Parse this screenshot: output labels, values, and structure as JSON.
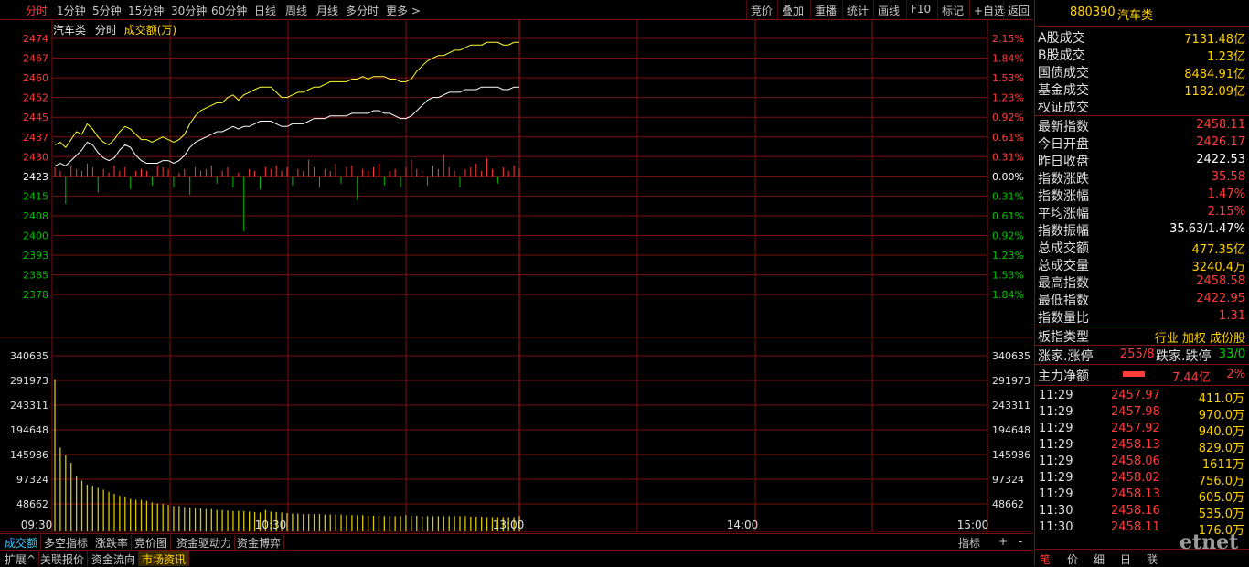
{
  "toolbar": {
    "periods": [
      "分时",
      "1分钟",
      "5分钟",
      "15分钟",
      "30分钟",
      "60分钟",
      "日线",
      "周线",
      "月线",
      "多分时",
      "更多 >"
    ],
    "active_period": "分时",
    "actions": [
      "竞价",
      "叠加",
      "重播",
      "统计",
      "画线",
      "F10",
      "标记",
      "+自选",
      "返回"
    ]
  },
  "chart_header": {
    "name": "汽车类",
    "mode": "分时",
    "indicator": "成交额(万)"
  },
  "chart_data": {
    "type": "line",
    "x_ticks": [
      "09:30",
      "10:30",
      "13:00",
      "14:00",
      "15:00"
    ],
    "price_ticks_left": [
      "2474",
      "2467",
      "2460",
      "2452",
      "2445",
      "2437",
      "2430",
      "2423",
      "2415",
      "2408",
      "2400",
      "2393",
      "2385",
      "2378"
    ],
    "pct_ticks_right": [
      "2.15%",
      "1.84%",
      "1.53%",
      "1.23%",
      "0.92%",
      "0.61%",
      "0.31%",
      "0.00%",
      "0.31%",
      "0.61%",
      "0.92%",
      "1.23%",
      "1.53%",
      "1.84%"
    ],
    "volume_ticks": [
      "340635",
      "291973",
      "243311",
      "194648",
      "145986",
      "97324",
      "48662"
    ],
    "ylim": [
      2378,
      2474
    ],
    "prev_close": 2422.53,
    "volume_ylim": [
      0,
      340635
    ],
    "series": [
      {
        "values": [
          2435,
          2436,
          2434,
          2437,
          2440,
          2439,
          2443,
          2441,
          2438,
          2436,
          2435,
          2437,
          2440,
          2442,
          2441,
          2439,
          2437,
          2437,
          2436,
          2437,
          2438,
          2437,
          2436,
          2437,
          2439,
          2443,
          2446,
          2448,
          2449,
          2450,
          2451,
          2451,
          2453,
          2454,
          2452,
          2454,
          2455,
          2456,
          2457,
          2457,
          2457,
          2455,
          2453,
          2453,
          2454,
          2455,
          2455,
          2456,
          2457,
          2457,
          2458,
          2459,
          2459,
          2459,
          2459,
          2460,
          2460,
          2461,
          2460,
          2461,
          2461,
          2461,
          2460,
          2460,
          2459,
          2459,
          2460,
          2463,
          2465,
          2467,
          2468,
          2469,
          2469,
          2470,
          2471,
          2471,
          2472,
          2473,
          2473,
          2473,
          2474,
          2474,
          2474,
          2473,
          2473,
          2474,
          2474
        ]
      },
      {
        "values": [
          2427,
          2428,
          2427,
          2429,
          2431,
          2433,
          2436,
          2435,
          2432,
          2430,
          2429,
          2430,
          2433,
          2435,
          2434,
          2431,
          2429,
          2428,
          2428,
          2428,
          2429,
          2429,
          2428,
          2429,
          2431,
          2434,
          2436,
          2437,
          2438,
          2439,
          2440,
          2440,
          2441,
          2442,
          2441,
          2442,
          2442,
          2443,
          2444,
          2444,
          2444,
          2443,
          2442,
          2442,
          2443,
          2443,
          2443,
          2444,
          2445,
          2445,
          2445,
          2446,
          2446,
          2446,
          2446,
          2447,
          2447,
          2447,
          2447,
          2448,
          2448,
          2447,
          2447,
          2446,
          2445,
          2445,
          2446,
          2448,
          2450,
          2452,
          2453,
          2453,
          2454,
          2455,
          2455,
          2455,
          2456,
          2456,
          2456,
          2457,
          2457,
          2457,
          2457,
          2456,
          2456,
          2457,
          2457
        ]
      }
    ],
    "line_colors": [
      "#ffff33",
      "#ffffff"
    ],
    "volume": [
      300000,
      165000,
      150000,
      135000,
      110000,
      100000,
      92000,
      90000,
      86000,
      82000,
      78000,
      74000,
      70000,
      68000,
      64000,
      62000,
      62000,
      60000,
      57000,
      55000,
      54000,
      52000,
      50000,
      50000,
      48000,
      47000,
      46000,
      45000,
      44000,
      44000,
      42000,
      42000,
      41000,
      40000,
      40000,
      40000,
      39000,
      38000,
      37000,
      42000,
      39000,
      38000,
      37000,
      36000,
      35000,
      35000,
      34000,
      34000,
      34000,
      34000,
      33000,
      33000,
      33000,
      33000,
      32000,
      32000,
      32000,
      32000,
      31000,
      31000,
      31000,
      30000,
      30000,
      30000,
      30000,
      32000,
      31000,
      31000,
      30000,
      30000,
      30000,
      30000,
      30000,
      30000,
      30000,
      30000,
      30000,
      29000,
      29000,
      29000,
      28000,
      28000,
      28000,
      28000,
      28000,
      28000,
      30000
    ],
    "volume_color": "#d8c800",
    "colors": {
      "up": "#ff3b3b",
      "down": "#00c000",
      "grid": "#7a1010",
      "axis_text_up": "#ff3b3b",
      "axis_text_down": "#00c000",
      "axis_text_mid": "#ffffff"
    }
  },
  "panel": {
    "code": "880390",
    "name": "汽车类",
    "turnover": [
      {
        "label": "A股成交",
        "value": "7131.48亿",
        "color": "y"
      },
      {
        "label": "B股成交",
        "value": "1.23亿",
        "color": "y"
      },
      {
        "label": "国债成交",
        "value": "8484.91亿",
        "color": "y"
      },
      {
        "label": "基金成交",
        "value": "1182.09亿",
        "color": "y"
      },
      {
        "label": "权证成交",
        "value": "",
        "color": "y"
      }
    ],
    "stats": [
      {
        "label": "最新指数",
        "value": "2458.11",
        "color": "r"
      },
      {
        "label": "今日开盘",
        "value": "2426.17",
        "color": "r"
      },
      {
        "label": "昨日收盘",
        "value": "2422.53",
        "color": "w"
      },
      {
        "label": "指数涨跌",
        "value": "35.58",
        "color": "r"
      },
      {
        "label": "指数涨幅",
        "value": "1.47%",
        "color": "r"
      },
      {
        "label": "平均涨幅",
        "value": "2.15%",
        "color": "r"
      },
      {
        "label": "指数振幅",
        "value": "35.63/1.47%",
        "color": "w"
      },
      {
        "label": "总成交额",
        "value": "477.35亿",
        "color": "y"
      },
      {
        "label": "总成交量",
        "value": "3240.4万",
        "color": "y"
      },
      {
        "label": "最高指数",
        "value": "2458.58",
        "color": "r"
      },
      {
        "label": "最低指数",
        "value": "2422.95",
        "color": "r"
      },
      {
        "label": "指数量比",
        "value": "1.31",
        "color": "r"
      }
    ],
    "board_type_label": "板指类型",
    "board_type_value": "行业 加权 成份股",
    "up_label": "涨家.涨停",
    "up_value": "255/8",
    "down_label": "跌家.跌停",
    "down_value": "33/0",
    "main_label": "主力净额",
    "main_value": "7.44亿",
    "main_pct": "2%",
    "trades": [
      {
        "time": "11:29",
        "price": "2457.97",
        "vol": "411.0万"
      },
      {
        "time": "11:29",
        "price": "2457.98",
        "vol": "970.0万"
      },
      {
        "time": "11:29",
        "price": "2457.92",
        "vol": "940.0万"
      },
      {
        "time": "11:29",
        "price": "2458.13",
        "vol": "829.0万"
      },
      {
        "time": "11:29",
        "price": "2458.06",
        "vol": "1611万"
      },
      {
        "time": "11:29",
        "price": "2458.02",
        "vol": "756.0万"
      },
      {
        "time": "11:29",
        "price": "2458.13",
        "vol": "605.0万"
      },
      {
        "time": "11:30",
        "price": "2458.16",
        "vol": "535.0万"
      },
      {
        "time": "11:30",
        "price": "2458.11",
        "vol": "176.0万"
      }
    ],
    "bottom_tabs": [
      "笔",
      "价",
      "细",
      "日",
      "联"
    ],
    "active_bottom_tab": "笔"
  },
  "tabs_row1": [
    "成交额",
    "多空指标",
    "涨跌率",
    "竞价图",
    "资金驱动力",
    "资金博弈"
  ],
  "tabs_row1_active": "成交额",
  "tabs_row1_right": [
    "指标",
    "+",
    "-"
  ],
  "tabs_row2": [
    "扩展^",
    "关联报价",
    "资金流向",
    "市场资讯"
  ],
  "tabs_row2_highlight": "市场资讯",
  "watermark": "etnet"
}
